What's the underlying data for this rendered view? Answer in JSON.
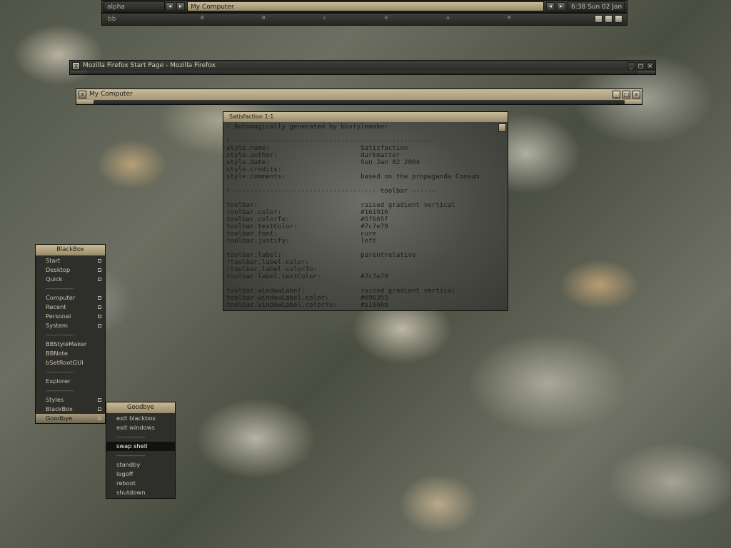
{
  "toolbar": {
    "workspace": "alpha",
    "window_label": "My Computer",
    "clock": "6:38 Sun 02 Jan",
    "row2_label": "bb",
    "row2_letters": [
      "B",
      "B",
      "L",
      "E",
      "A",
      "R"
    ],
    "prev_arrow": "◂",
    "next_arrow": "▸"
  },
  "windows": {
    "firefox_title": "Mozilla Firefox Start Page - Mozilla Firefox",
    "mycomputer_title": "My Computer",
    "minimize_glyph": "_",
    "maximize_glyph": "□",
    "close_glyph": "×",
    "icon_glyph": "⧖"
  },
  "note": {
    "title": "Satisfaction 1:1",
    "lines": [
      "! Automagically generated by bbstylemaker",
      "",
      "! --------------------------------------------------",
      "style.name:                       Satisfaction",
      "style.author:                     darkmatter",
      "style.date:                       Sun Jan 02 2004",
      "style.credits:",
      "style.comments:                   based on the propaganda Consum",
      "",
      "! ------------------------------------ toolbar ------",
      "",
      "toolbar:                          raised gradient vertical",
      "toolbar.color:                    #161916",
      "toolbar.colorTo:                  #5f665f",
      "toolbar.textColor:                #7c7e79",
      "toolbar.font:                     cure",
      "toolbar.justify:                  left",
      "",
      "toolbar.label:                    parentrelative",
      "!toolbar.label.color:",
      "!toolbar.label.colorTo:",
      "toolbar.label.textColor:          #7c7e79",
      "",
      "toolbar.windowLabel:              raised gradient vertical",
      "toolbar.windowLabel.color:        #696353",
      "toolbar.windowLabel.colorTo:      #a1866b"
    ]
  },
  "blackbox_menu": {
    "title": "BlackBox",
    "items": [
      {
        "label": "Start",
        "type": "sub"
      },
      {
        "label": "Desktop",
        "type": "sub"
      },
      {
        "label": "Quick",
        "type": "sub"
      },
      {
        "label": "--------------",
        "type": "sep"
      },
      {
        "label": "Computer",
        "type": "sub"
      },
      {
        "label": "Recent",
        "type": "sub"
      },
      {
        "label": "Personal",
        "type": "sub"
      },
      {
        "label": "System",
        "type": "sub"
      },
      {
        "label": "--------------",
        "type": "sep"
      },
      {
        "label": "BBStyleMaker",
        "type": "item"
      },
      {
        "label": "BBNote",
        "type": "item"
      },
      {
        "label": "bSetRootGUI",
        "type": "item"
      },
      {
        "label": "--------------",
        "type": "sep"
      },
      {
        "label": "Explorer",
        "type": "item"
      },
      {
        "label": "--------------",
        "type": "sep"
      },
      {
        "label": "Styles",
        "type": "sub"
      },
      {
        "label": "BlackBox",
        "type": "sub"
      },
      {
        "label": "Goodbye",
        "type": "sub",
        "active": true
      }
    ]
  },
  "goodbye_menu": {
    "title": "Goodbye",
    "items": [
      {
        "label": "exit blackbox",
        "type": "item"
      },
      {
        "label": "exit windows",
        "type": "item"
      },
      {
        "label": "--------------",
        "type": "sep"
      },
      {
        "label": "swap shell",
        "type": "item",
        "highlight": true
      },
      {
        "label": "--------------",
        "type": "sep"
      },
      {
        "label": "standby",
        "type": "item"
      },
      {
        "label": "logoff",
        "type": "item"
      },
      {
        "label": "reboot",
        "type": "item"
      },
      {
        "label": "shutdown",
        "type": "item"
      }
    ]
  },
  "colors": {
    "accent_gold": "#c9bb99",
    "panel_dark": "#2e2f2a",
    "menu_text": "#c9c4b0"
  }
}
